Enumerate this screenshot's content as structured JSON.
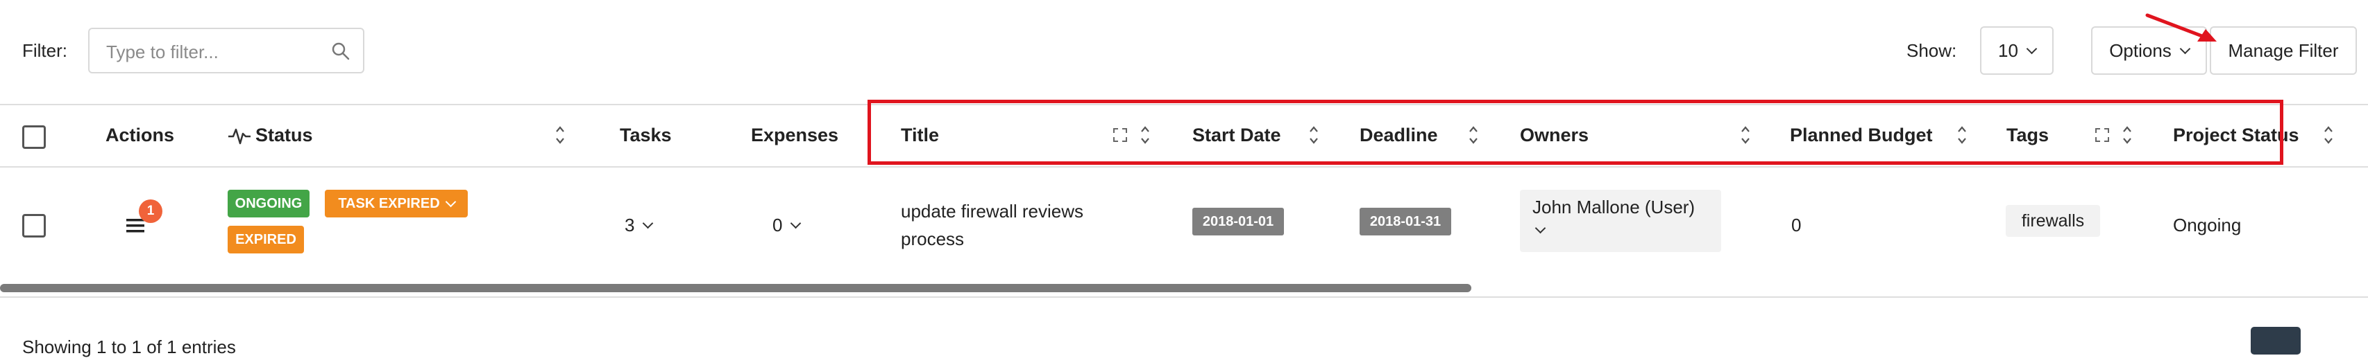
{
  "toolbar": {
    "filter_label": "Filter:",
    "filter_placeholder": "Type to filter...",
    "show_label": "Show:",
    "page_size": "10",
    "options_label": "Options",
    "manage_filter_label": "Manage Filter"
  },
  "columns": [
    {
      "label": "Actions"
    },
    {
      "label": "Status"
    },
    {
      "label": "Tasks"
    },
    {
      "label": "Expenses"
    },
    {
      "label": "Title"
    },
    {
      "label": "Start Date"
    },
    {
      "label": "Deadline"
    },
    {
      "label": "Owners"
    },
    {
      "label": "Planned Budget"
    },
    {
      "label": "Tags"
    },
    {
      "label": "Project Status"
    }
  ],
  "rows": [
    {
      "action_count": "1",
      "status_badges": [
        "ONGOING",
        "TASK EXPIRED",
        "EXPIRED"
      ],
      "tasks": "3",
      "expenses": "0",
      "title_line1": "update firewall reviews",
      "title_line2": "process",
      "start_date": "2018-01-01",
      "deadline": "2018-01-31",
      "owner": "John Mallone (User)",
      "planned_budget": "0",
      "tag": "firewalls",
      "project_status": "Ongoing"
    }
  ],
  "footer": {
    "summary": "Showing 1 to 1 of 1 entries"
  },
  "colors": {
    "highlight": "#e0141e",
    "ongoing": "#43a547",
    "expired": "#f28c1e",
    "notification": "#f0633a"
  }
}
